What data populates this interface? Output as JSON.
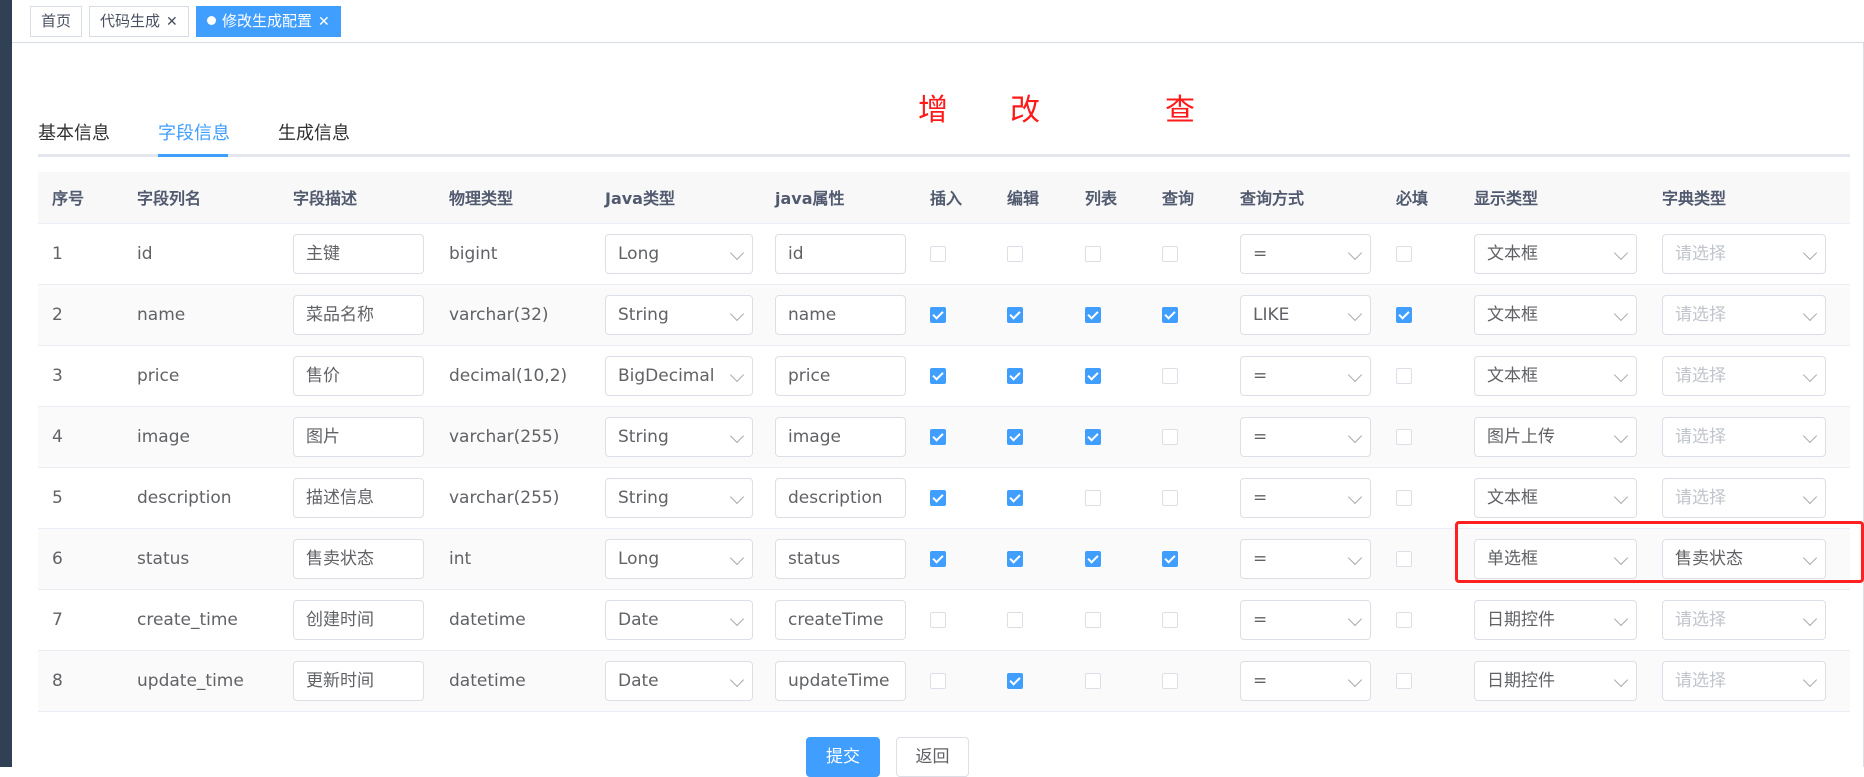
{
  "tags": [
    {
      "label": "首页",
      "active": false
    },
    {
      "label": "代码生成",
      "active": false,
      "closable": true
    },
    {
      "label": "修改生成配置",
      "active": true,
      "closable": true
    }
  ],
  "tabs": [
    "基本信息",
    "字段信息",
    "生成信息"
  ],
  "active_tab": 1,
  "annotations": {
    "insert": "增",
    "edit": "改",
    "query": "查"
  },
  "columns": [
    "序号",
    "字段列名",
    "字段描述",
    "物理类型",
    "Java类型",
    "java属性",
    "插入",
    "编辑",
    "列表",
    "查询",
    "查询方式",
    "必填",
    "显示类型",
    "字典类型"
  ],
  "dict_placeholder": "请选择",
  "rows": [
    {
      "no": "1",
      "name": "id",
      "desc": "主键",
      "ptype": "bigint",
      "jtype": "Long",
      "attr": "id",
      "insert": false,
      "edit": false,
      "list": false,
      "query": false,
      "qmode": "=",
      "required": false,
      "display": "文本框",
      "dict": ""
    },
    {
      "no": "2",
      "name": "name",
      "desc": "菜品名称",
      "ptype": "varchar(32)",
      "jtype": "String",
      "attr": "name",
      "insert": true,
      "edit": true,
      "list": true,
      "query": true,
      "qmode": "LIKE",
      "required": true,
      "display": "文本框",
      "dict": ""
    },
    {
      "no": "3",
      "name": "price",
      "desc": "售价",
      "ptype": "decimal(10,2)",
      "jtype": "BigDecimal",
      "attr": "price",
      "insert": true,
      "edit": true,
      "list": true,
      "query": false,
      "qmode": "=",
      "required": false,
      "display": "文本框",
      "dict": ""
    },
    {
      "no": "4",
      "name": "image",
      "desc": "图片",
      "ptype": "varchar(255)",
      "jtype": "String",
      "attr": "image",
      "insert": true,
      "edit": true,
      "list": true,
      "query": false,
      "qmode": "=",
      "required": false,
      "display": "图片上传",
      "dict": ""
    },
    {
      "no": "5",
      "name": "description",
      "desc": "描述信息",
      "ptype": "varchar(255)",
      "jtype": "String",
      "attr": "description",
      "insert": true,
      "edit": true,
      "list": false,
      "query": false,
      "qmode": "=",
      "required": false,
      "display": "文本框",
      "dict": ""
    },
    {
      "no": "6",
      "name": "status",
      "desc": "售卖状态",
      "ptype": "int",
      "jtype": "Long",
      "attr": "status",
      "insert": true,
      "edit": true,
      "list": true,
      "query": true,
      "qmode": "=",
      "required": false,
      "display": "单选框",
      "dict": "售卖状态"
    },
    {
      "no": "7",
      "name": "create_time",
      "desc": "创建时间",
      "ptype": "datetime",
      "jtype": "Date",
      "attr": "createTime",
      "insert": false,
      "edit": false,
      "list": false,
      "query": false,
      "qmode": "=",
      "required": false,
      "display": "日期控件",
      "dict": ""
    },
    {
      "no": "8",
      "name": "update_time",
      "desc": "更新时间",
      "ptype": "datetime",
      "jtype": "Date",
      "attr": "updateTime",
      "insert": false,
      "edit": true,
      "list": false,
      "query": false,
      "qmode": "=",
      "required": false,
      "display": "日期控件",
      "dict": ""
    }
  ],
  "buttons": {
    "submit": "提交",
    "back": "返回"
  },
  "colors": {
    "primary": "#409eff",
    "highlight": "#ff2020",
    "annotation": "#ff1a1a"
  }
}
